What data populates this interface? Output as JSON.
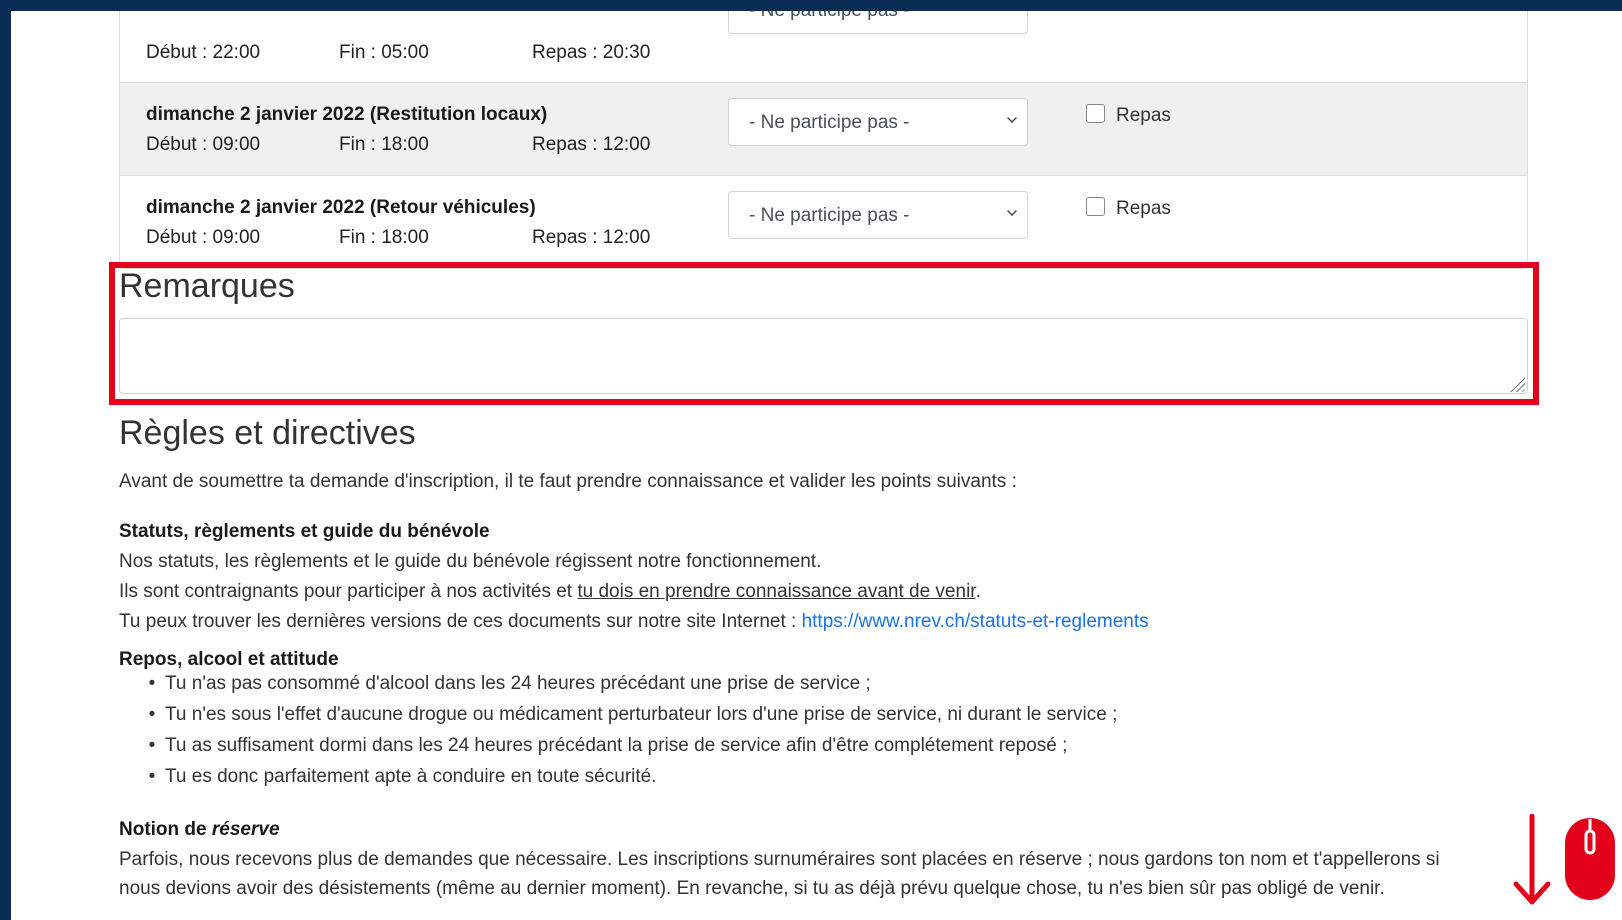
{
  "sessions": [
    {
      "title": "",
      "start": "Début : 22:00",
      "end": "Fin : 05:00",
      "meal": "Repas : 20:30",
      "select": "- Ne participe pas -",
      "meal_checkbox": ""
    },
    {
      "title": "dimanche 2 janvier 2022 (Restitution locaux)",
      "start": "Début : 09:00",
      "end": "Fin : 18:00",
      "meal": "Repas : 12:00",
      "select": "- Ne participe pas -",
      "meal_checkbox": "Repas"
    },
    {
      "title": "dimanche 2 janvier 2022 (Retour véhicules)",
      "start": "Début : 09:00",
      "end": "Fin : 18:00",
      "meal": "Repas : 12:00",
      "select": "- Ne participe pas -",
      "meal_checkbox": "Repas"
    }
  ],
  "remarks": {
    "label": "Remarques",
    "value": "",
    "placeholder": ""
  },
  "rules": {
    "title": "Règles et directives",
    "intro": "Avant de soumettre ta demande d'inscription, il te faut prendre connaissance et valider les points suivants :",
    "statuts": {
      "heading": "Statuts, règlements et guide du bénévole",
      "line1": "Nos statuts, les règlements et le guide du bénévole régissent notre fonctionnement.",
      "line2_pre": "Ils sont contraignants pour participer à nos activités et ",
      "line2_underlined": "tu dois en prendre connaissance avant de venir",
      "line2_post": ".",
      "line3_pre": "Tu peux trouver les dernières versions de ces documents sur notre site Internet : ",
      "link": "https://www.nrev.ch/statuts-et-reglements"
    },
    "repos": {
      "heading": "Repos, alcool et attitude",
      "items": [
        "Tu n'as pas consommé d'alcool dans les 24 heures précédant une prise de service ;",
        "Tu n'es sous l'effet d'aucune drogue ou médicament perturbateur lors d'une prise de service, ni durant le service ;",
        "Tu as suffisament dormi dans les 24 heures précédant la prise de service afin d'être complétement reposé ;",
        "Tu es donc parfaitement apte à conduire en toute sécurité."
      ]
    },
    "reserve": {
      "heading_pre": "Notion de ",
      "heading_italic": "réserve",
      "line1": "Parfois, nous recevons plus de demandes que nécessaire. Les inscriptions surnuméraires sont placées en réserve ; nous gardons ton nom et t'appellerons si",
      "line2": "nous devions avoir des désistements (même au dernier moment). En revanche, si tu as déjà prévu quelque chose, tu n'es bien sûr pas obligé de venir."
    }
  },
  "colors": {
    "highlight": "#e2001a",
    "link": "#1a73e8",
    "frame": "#0b2d55"
  }
}
